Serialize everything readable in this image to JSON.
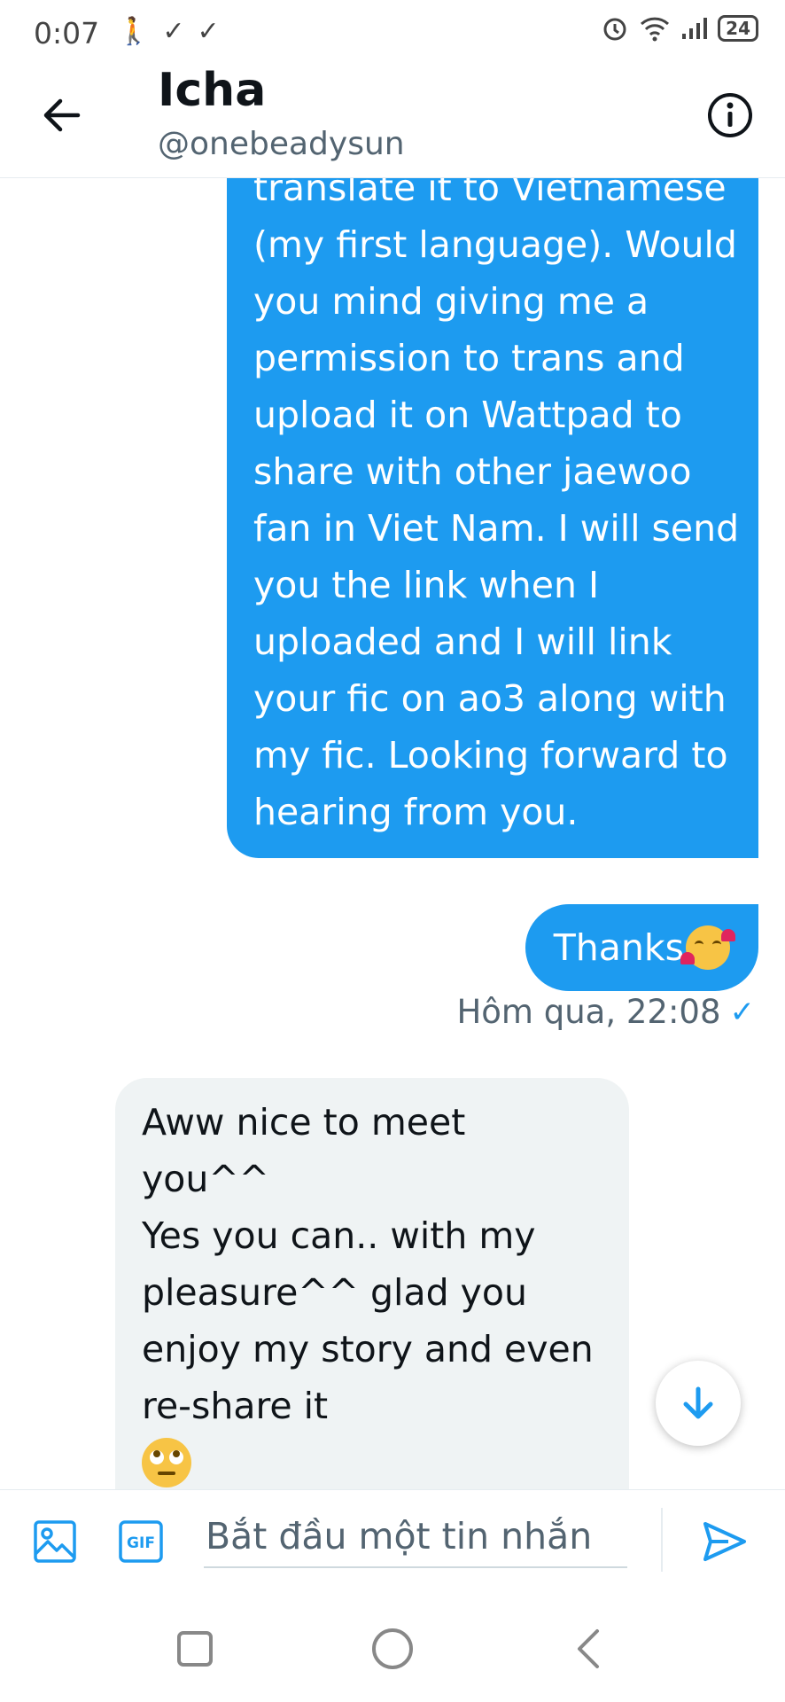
{
  "status_bar": {
    "time": "0:07",
    "battery": "24"
  },
  "header": {
    "title": "Icha",
    "handle": "@onebeadysun"
  },
  "messages": {
    "outgoing_long": "translate it to Vietnamese (my first language). Would you mind giving me a permission to trans and upload it on Wattpad to share with other jaewoo fan in Viet Nam. I will send you the link when I uploaded and I will link your fic on  ao3 along with my fic. Looking forward to hearing from you.",
    "outgoing_thanks": "Thanks",
    "timestamp": "Hôm qua, 22:08",
    "incoming_line1": "Aww nice to meet you^^",
    "incoming_line2": "Yes you can.. with my pleasure^^ glad you enjoy my story and even re-share it"
  },
  "composer": {
    "placeholder": "Bắt đầu một tin nhắn",
    "gif_label": "GIF"
  },
  "colors": {
    "accent": "#1d9bf0",
    "incoming_bubble": "#eff3f4",
    "secondary_text": "#536471"
  },
  "icons": [
    "back-arrow-icon",
    "info-icon",
    "image-icon",
    "gif-icon",
    "send-icon",
    "arrow-down-icon",
    "square-icon",
    "circle-icon",
    "chevron-left-icon"
  ]
}
